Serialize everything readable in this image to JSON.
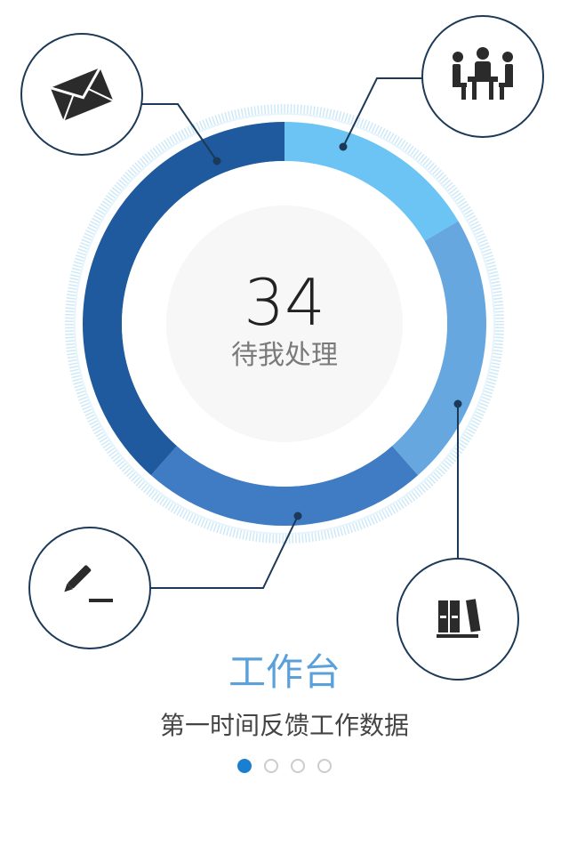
{
  "center": {
    "count": "34",
    "label": "待我处理"
  },
  "caption": {
    "title": "工作台",
    "subtitle": "第一时间反馈工作数据"
  },
  "pager": {
    "pages": 4,
    "active_index": 0
  },
  "ring_segments": [
    {
      "name": "meeting-segment",
      "color": "#6cc4f4",
      "fraction": 0.165
    },
    {
      "name": "library-segment",
      "color": "#67a7e0",
      "fraction": 0.22
    },
    {
      "name": "edit-segment",
      "color": "#3f7cc4",
      "fraction": 0.23
    },
    {
      "name": "mail-segment",
      "color": "#1f5a9e",
      "fraction": 0.385
    }
  ],
  "icons": {
    "mail": "envelope-icon",
    "meeting": "meeting-icon",
    "edit": "pen-icon",
    "library": "binders-icon"
  },
  "colors": {
    "accent": "#5aa1dc",
    "active_dot": "#1a7fd0",
    "line": "#1c3a57"
  }
}
